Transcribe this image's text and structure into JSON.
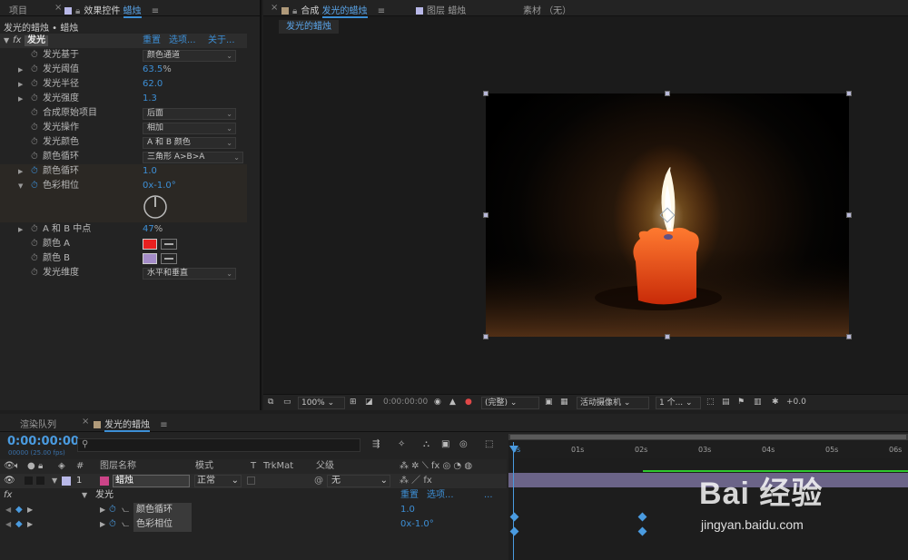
{
  "effects_panel": {
    "tabs": [
      {
        "label": "项目"
      },
      {
        "prefix": "效果控件",
        "label": "蜡烛"
      }
    ],
    "breadcrumb": "发光的蜡烛 • 蜡烛",
    "effect_name": "发光",
    "effect_links": [
      "重置",
      "选项...",
      "关于..."
    ],
    "properties": [
      {
        "name": "发光基于",
        "type": "dropdown",
        "value": "颜色通道"
      },
      {
        "name": "发光阈值",
        "type": "value",
        "value": "63.5",
        "unit": "%"
      },
      {
        "name": "发光半径",
        "type": "value",
        "value": "62.0"
      },
      {
        "name": "发光强度",
        "type": "value",
        "value": "1.3"
      },
      {
        "name": "合成原始项目",
        "type": "dropdown",
        "value": "后面"
      },
      {
        "name": "发光操作",
        "type": "dropdown",
        "value": "相加"
      },
      {
        "name": "发光颜色",
        "type": "dropdown",
        "value": "A 和 B 颜色"
      },
      {
        "name": "颜色循环",
        "type": "dropdown",
        "value": "三角形 A>B>A"
      },
      {
        "name": "颜色循环",
        "type": "value",
        "value": "1.0"
      },
      {
        "name": "色彩相位",
        "type": "value",
        "value": "0x-1.0°"
      },
      {
        "name": "A 和 B 中点",
        "type": "value",
        "value": "47",
        "unit": "%"
      },
      {
        "name": "颜色 A",
        "type": "color",
        "value": "#e82020"
      },
      {
        "name": "颜色 B",
        "type": "color",
        "value": "#a48cc8"
      },
      {
        "name": "发光维度",
        "type": "dropdown",
        "value": "水平和垂直"
      }
    ]
  },
  "comp_panel": {
    "tabs": [
      {
        "prefix": "合成",
        "label": "发光的蜡烛"
      },
      {
        "prefix": "图层",
        "label": "蜡烛"
      },
      {
        "prefix": "素材",
        "label": "（无）"
      }
    ],
    "sub_tab": "发光的蜡烛",
    "toolbar": {
      "zoom": "100%",
      "timecode": "0:00:00:00",
      "resolution": "(完整)",
      "camera": "活动摄像机",
      "views": "1 个...",
      "exposure": "+0.0"
    }
  },
  "timeline": {
    "tabs": [
      {
        "label": "渲染队列"
      },
      {
        "label": "发光的蜡烛"
      }
    ],
    "timecode": "0:00:00:00",
    "frame_info": "00000 (25.00 fps)",
    "search_icon": "search-icon",
    "columns": [
      "#",
      "图层名称",
      "模式",
      "T",
      "TrkMat",
      "父级"
    ],
    "layer": {
      "number": "1",
      "name": "蜡烛",
      "mode": "正常",
      "parent": "无"
    },
    "effect_row": {
      "label": "发光",
      "reset": "重置",
      "options": "选项...",
      "more": "..."
    },
    "property_rows": [
      {
        "name": "颜色循环",
        "value": "1.0"
      },
      {
        "name": "色彩相位",
        "value": "0x-1.0°"
      }
    ],
    "ruler_labels": [
      "0s",
      "01s",
      "02s",
      "03s",
      "04s",
      "05s",
      "06s"
    ]
  },
  "watermark": {
    "logo": "Bai 经验",
    "url": "jingyan.baidu.com"
  },
  "colors": {
    "accent": "#3d8fd6",
    "color_a": "#e82020",
    "color_b": "#a48cc8",
    "layer_label": "#b8b8e8"
  }
}
